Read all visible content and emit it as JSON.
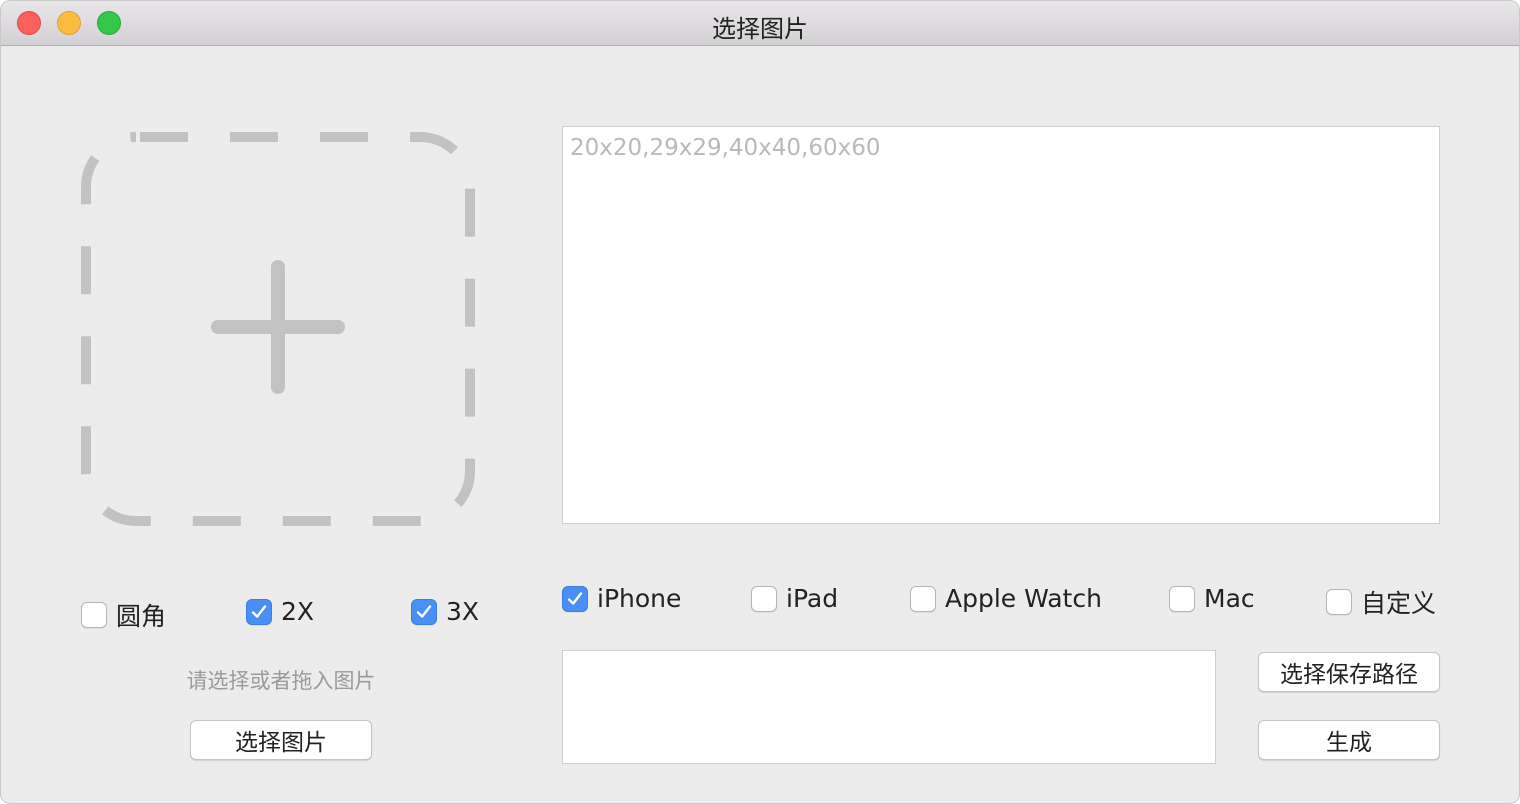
{
  "window": {
    "title": "选择图片"
  },
  "left_panel": {
    "options": [
      {
        "label": "圆角",
        "checked": false
      },
      {
        "label": "2X",
        "checked": true
      },
      {
        "label": "3X",
        "checked": true
      }
    ],
    "hint": "请选择或者拖入图片",
    "select_button": "选择图片"
  },
  "right_panel": {
    "sizes_placeholder": "20x20,29x29,40x40,60x60",
    "sizes_value": "",
    "devices": [
      {
        "label": "iPhone",
        "checked": true
      },
      {
        "label": "iPad",
        "checked": false
      },
      {
        "label": "Apple Watch",
        "checked": false
      },
      {
        "label": "Mac",
        "checked": false
      },
      {
        "label": "自定义",
        "checked": false
      }
    ],
    "save_path_value": "",
    "choose_path_button": "选择保存路径",
    "generate_button": "生成"
  },
  "colors": {
    "accent": "#4a8ff5",
    "window_bg": "#ececec"
  },
  "icons": [
    "add-image-icon",
    "checkmark-icon"
  ]
}
